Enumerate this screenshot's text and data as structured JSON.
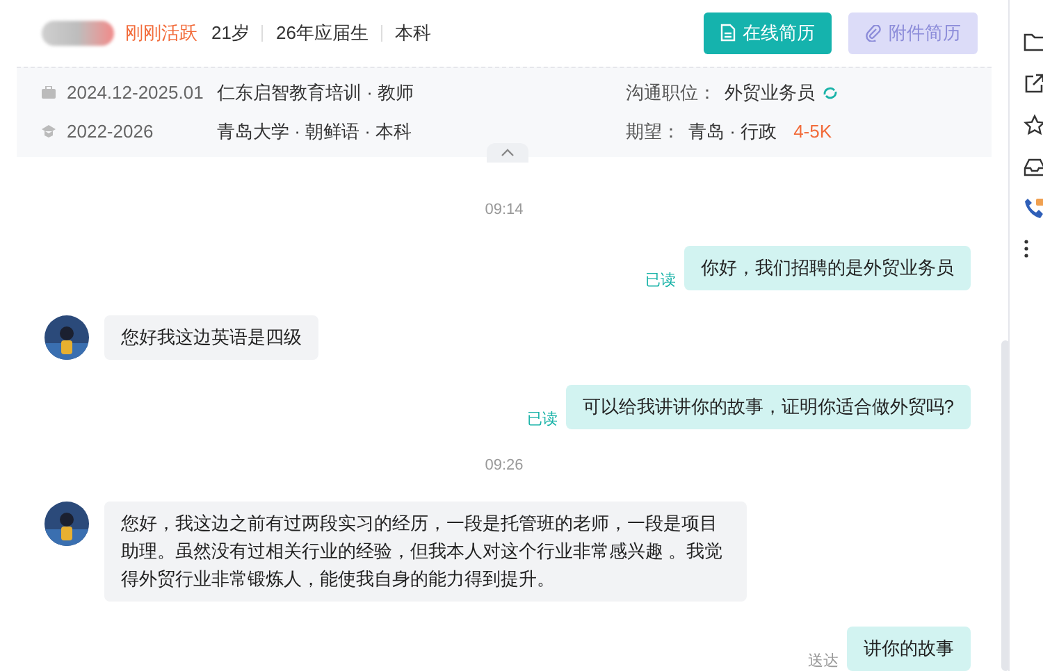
{
  "candidate": {
    "activity": "刚刚活跃",
    "details": [
      "21岁",
      "26年应届生",
      "本科"
    ]
  },
  "buttons": [
    {
      "label": "在线简历",
      "disabled": false
    },
    {
      "label": "附件简历",
      "disabled": true
    }
  ],
  "info": {
    "experience": [
      {
        "kind": "work",
        "period": "2024.12-2025.01",
        "text": "仁东启智教育培训 · 教师"
      },
      {
        "kind": "education",
        "period": "2022-2026",
        "text": "青岛大学 · 朝鲜语 · 本科"
      }
    ],
    "position_label": "沟通职位：",
    "position": "外贸业务员",
    "expect_label": "期望：",
    "expect": "青岛 · 行政",
    "salary": "4-5K"
  },
  "messages": [
    {
      "kind": "time",
      "text": "09:14"
    },
    {
      "kind": "sent",
      "text": "你好，我们招聘的是外贸业务员",
      "status": "已读",
      "read": true
    },
    {
      "kind": "received",
      "text": "您好我这边英语是四级"
    },
    {
      "kind": "sent",
      "text": "可以给我讲讲你的故事，证明你适合做外贸吗?",
      "status": "已读",
      "read": true
    },
    {
      "kind": "time",
      "text": "09:26"
    },
    {
      "kind": "received",
      "text": "您好，我这边之前有过两段实习的经历，一段是托管班的老师，一段是项目助理。虽然没有过相关行业的经验，但我本人对这个行业非常感兴趣 。我觉得外贸行业非常锻炼人，能使我自身的能力得到提升。"
    },
    {
      "kind": "sent",
      "text": "讲你的故事",
      "status": "送达",
      "read": false
    }
  ]
}
